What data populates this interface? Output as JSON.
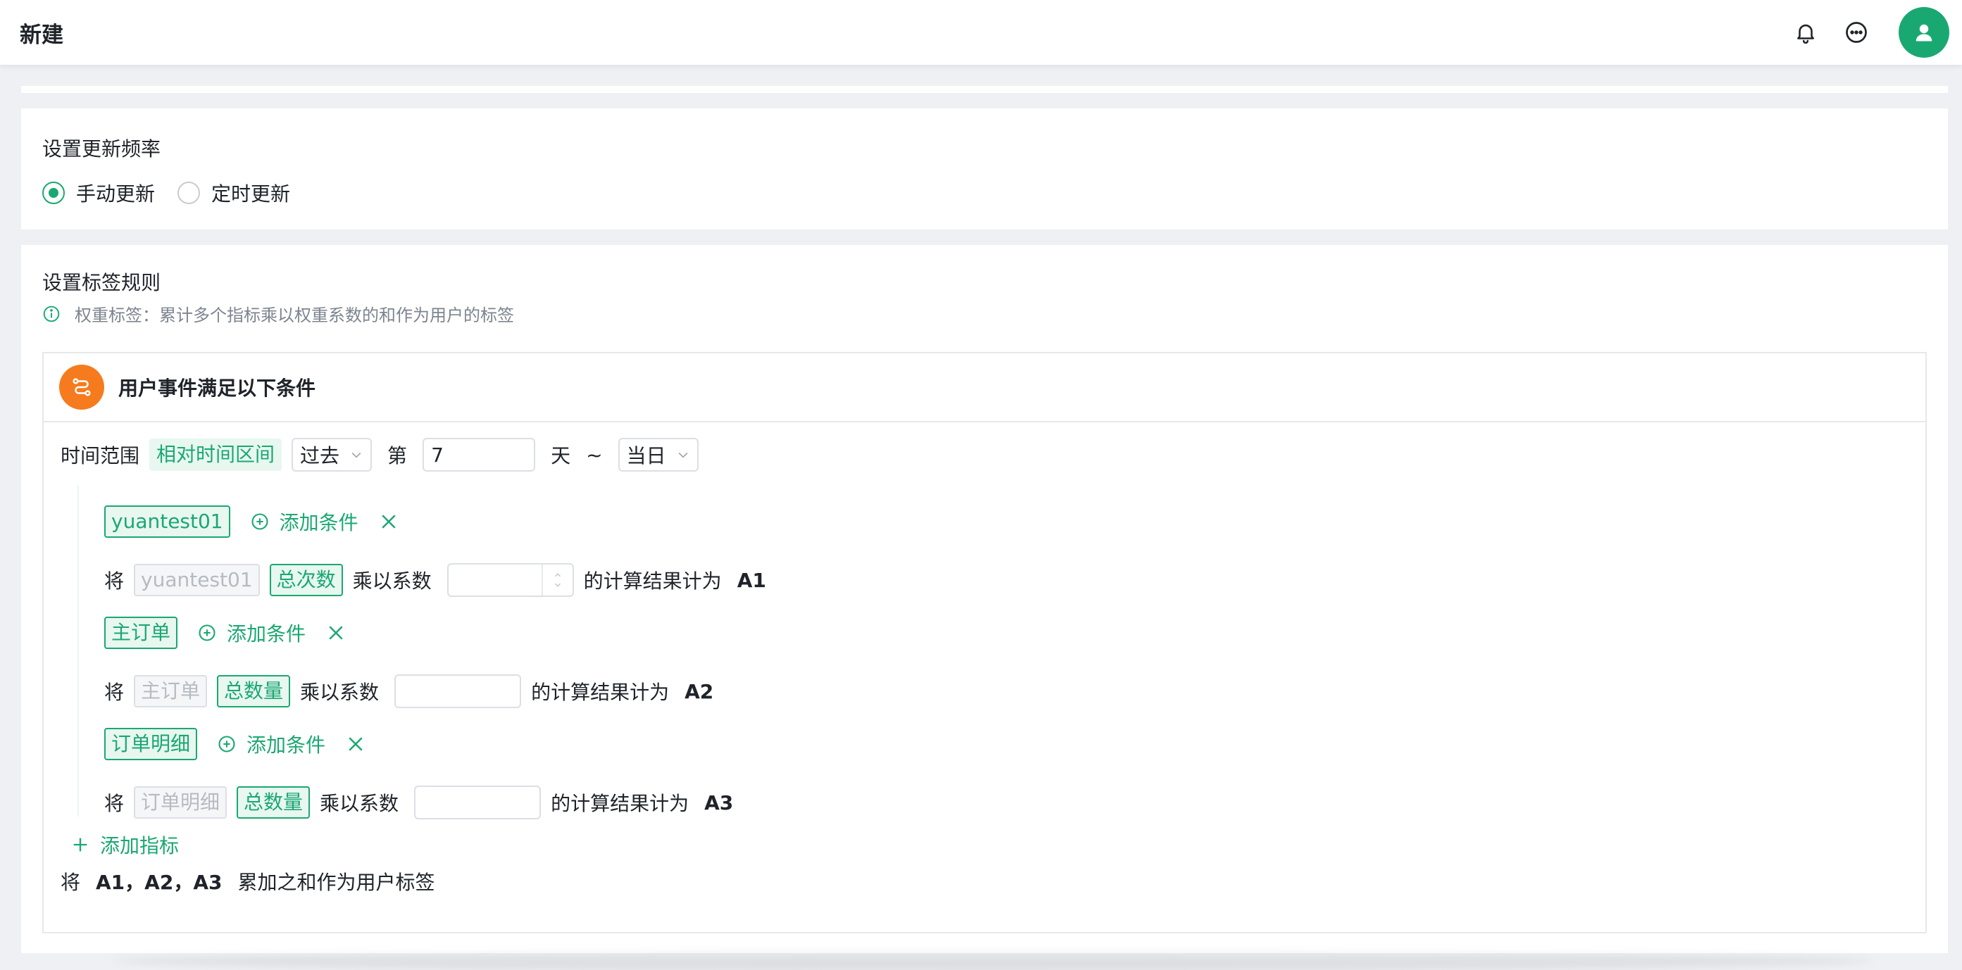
{
  "header": {
    "title": "新建",
    "icons": [
      "bell-icon",
      "chat-icon",
      "user-icon"
    ]
  },
  "frequency": {
    "title": "设置更新频率",
    "options": [
      {
        "label": "手动更新",
        "selected": true
      },
      {
        "label": "定时更新",
        "selected": false
      }
    ]
  },
  "rules": {
    "title": "设置标签规则",
    "hint": "权重标签：累计多个指标乘以权重系数的和作为用户的标签",
    "panel_title": "用户事件满足以下条件",
    "time_range": {
      "label": "时间范围",
      "mode": "相对时间区间",
      "direction": "过去",
      "ordinal": "第",
      "value": "7",
      "unit": "天",
      "tilde": "~",
      "end": "当日"
    },
    "metrics": [
      {
        "event": "yuantest01",
        "add_condition": "添加条件",
        "prefix": "将",
        "event_ref": "yuantest01",
        "agg": "总次数",
        "multiply": "乘以系数",
        "result_text": "的计算结果计为",
        "result": "A1"
      },
      {
        "event": "主订单",
        "add_condition": "添加条件",
        "prefix": "将",
        "event_ref": "主订单",
        "agg": "总数量",
        "multiply": "乘以系数",
        "result_text": "的计算结果计为",
        "result": "A2"
      },
      {
        "event": "订单明细",
        "add_condition": "添加条件",
        "prefix": "将",
        "event_ref": "订单明细",
        "agg": "总数量",
        "multiply": "乘以系数",
        "result_text": "的计算结果计为",
        "result": "A3"
      }
    ],
    "add_metric": "添加指标",
    "summary": {
      "prefix": "将",
      "vars": "A1，A2，A3",
      "suffix": "累加之和作为用户标签"
    }
  },
  "colors": {
    "accent": "#1aa872",
    "accent_bg": "#e8f7f0",
    "orange": "#f57b1e"
  }
}
